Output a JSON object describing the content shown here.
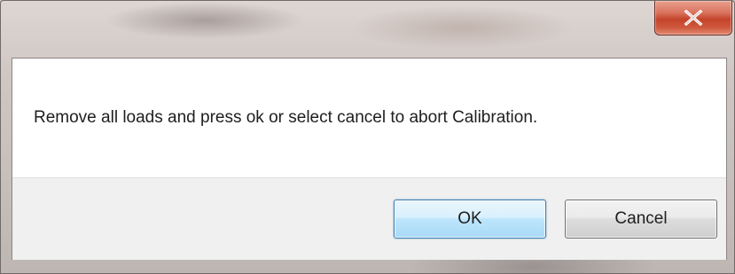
{
  "dialog": {
    "title": "",
    "message": "Remove all loads and press ok or select cancel to abort Calibration.",
    "close_icon": "close-x-icon"
  },
  "buttons": {
    "ok_label": "OK",
    "cancel_label": "Cancel"
  },
  "colors": {
    "close_button": "#c4432a",
    "default_button_border": "#3c7fb1",
    "content_background": "#ffffff",
    "footer_background": "#f0f0f0"
  }
}
